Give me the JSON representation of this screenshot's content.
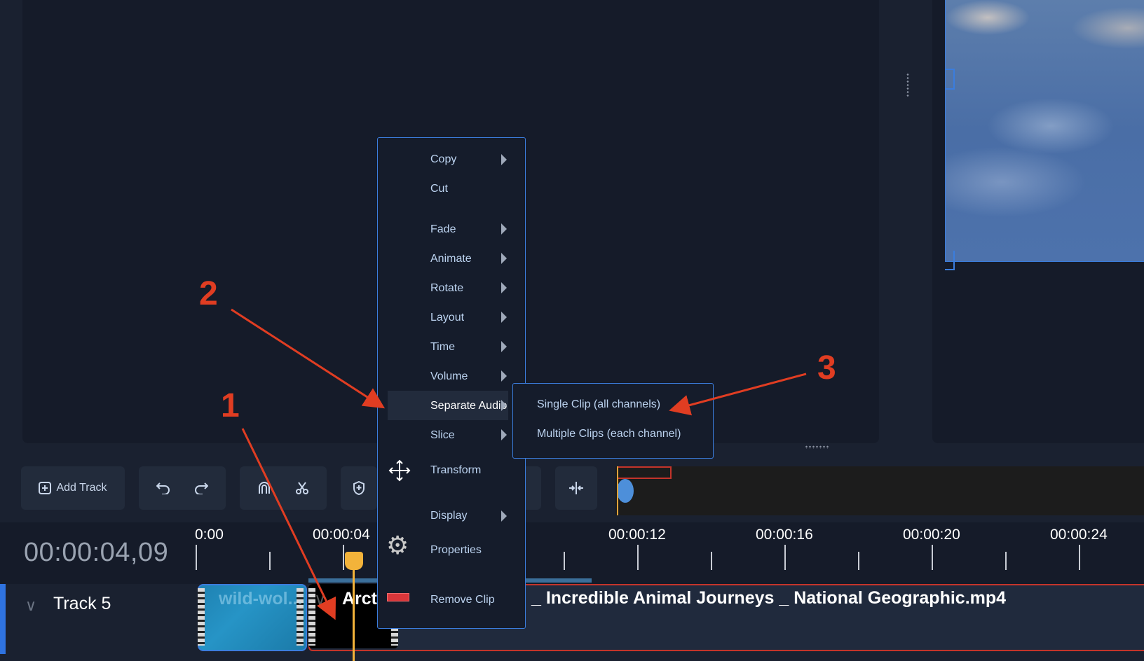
{
  "timecode": "00:00:04,09",
  "toolbar": {
    "add_track_label": "Add Track"
  },
  "ruler": {
    "labels": [
      "0:00",
      "00:00:04",
      "00:00:12",
      "00:00:16",
      "00:00:20",
      "00:00:24"
    ]
  },
  "track": {
    "name": "Track 5",
    "clips": {
      "wild": "wild-wol...",
      "arctic": "Arcti",
      "main": "_ Incredible Animal Journeys _ National Geographic.mp4"
    }
  },
  "context_menu": {
    "items": {
      "copy": "Copy",
      "cut": "Cut",
      "fade": "Fade",
      "animate": "Animate",
      "rotate": "Rotate",
      "layout": "Layout",
      "time": "Time",
      "volume": "Volume",
      "separate_audio": "Separate Audio",
      "slice": "Slice",
      "transform": "Transform",
      "display": "Display",
      "properties": "Properties",
      "remove_clip": "Remove Clip"
    },
    "submenu": {
      "single": "Single Clip (all channels)",
      "multiple": "Multiple Clips (each channel)"
    }
  },
  "annotations": {
    "one": "1",
    "two": "2",
    "three": "3"
  },
  "colors": {
    "accent": "#3b7ddd",
    "annotation": "#e03d22",
    "playhead": "#f3b33a",
    "clip_border_selected": "#c4342a"
  }
}
